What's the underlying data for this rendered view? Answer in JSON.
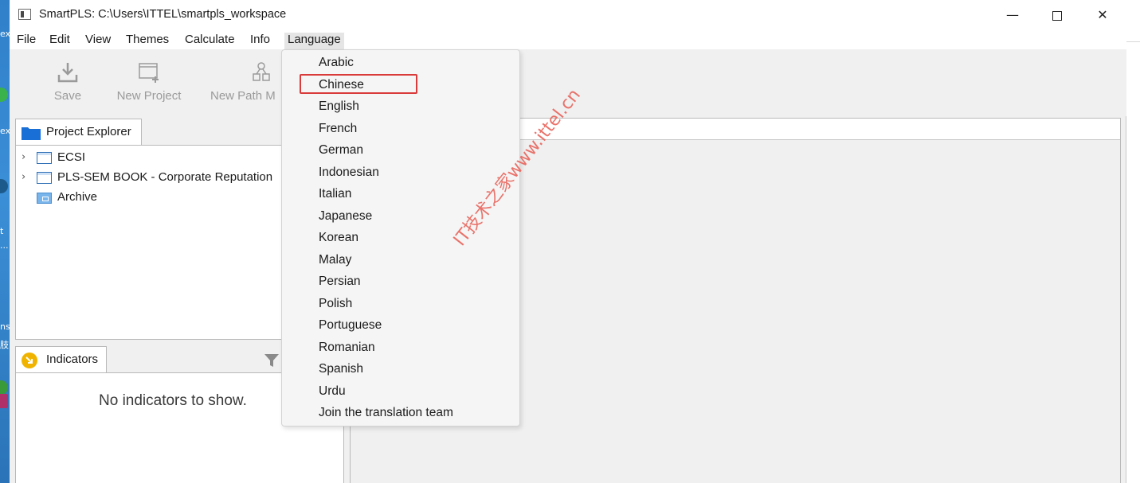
{
  "window": {
    "title": "SmartPLS: C:\\Users\\ITTEL\\smartpls_workspace",
    "minimize_glyph": "—",
    "close_glyph": "✕"
  },
  "menubar": {
    "items": [
      "File",
      "Edit",
      "View",
      "Themes",
      "Calculate",
      "Info",
      "Language"
    ],
    "active": "Language"
  },
  "toolbar": {
    "save_label": "Save",
    "new_project_label": "New Project",
    "new_path_model_label": "New Path M"
  },
  "project_explorer": {
    "tab_label": "Project Explorer",
    "items": [
      {
        "label": "ECSI",
        "icon": "project-icon",
        "expandable": true
      },
      {
        "label": "PLS-SEM BOOK - Corporate Reputation",
        "icon": "project-icon",
        "expandable": true
      },
      {
        "label": "Archive",
        "icon": "archive-folder-icon",
        "expandable": false
      }
    ]
  },
  "indicators": {
    "tab_label": "Indicators",
    "empty_message": "No indicators to show."
  },
  "language_menu": {
    "items": [
      "Arabic",
      "Chinese",
      "English",
      "French",
      "German",
      "Indonesian",
      "Italian",
      "Japanese",
      "Korean",
      "Malay",
      "Persian",
      "Polish",
      "Portuguese",
      "Romanian",
      "Spanish",
      "Urdu",
      "Join the translation team"
    ],
    "highlighted": "Chinese",
    "highlight_color": "#d93a3a"
  },
  "watermark": "IT技术之家www.ittel.cn",
  "desktop_fragments": [
    "ex",
    "ex",
    "t",
    "...",
    "ns",
    "肢"
  ]
}
